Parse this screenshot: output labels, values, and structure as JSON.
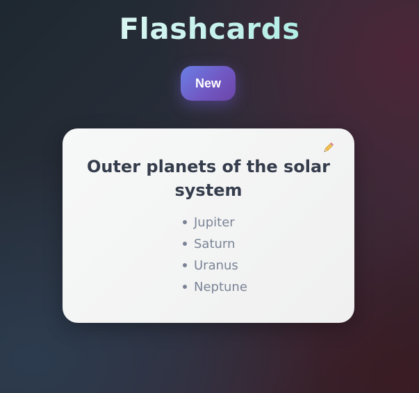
{
  "app": {
    "title": "Flashcards"
  },
  "toolbar": {
    "new_label": "New"
  },
  "card": {
    "title": "Outer planets of the solar system",
    "items": [
      "Jupiter",
      "Saturn",
      "Uranus",
      "Neptune"
    ],
    "edit_icon": "pencil-icon"
  },
  "colors": {
    "title_accent": "#bdf4ec",
    "button_gradient_start": "#6a80e6",
    "button_gradient_end": "#6c45a8",
    "card_background": "#f3f3f3",
    "card_title": "#353d4c",
    "item_text": "#7a8496"
  }
}
